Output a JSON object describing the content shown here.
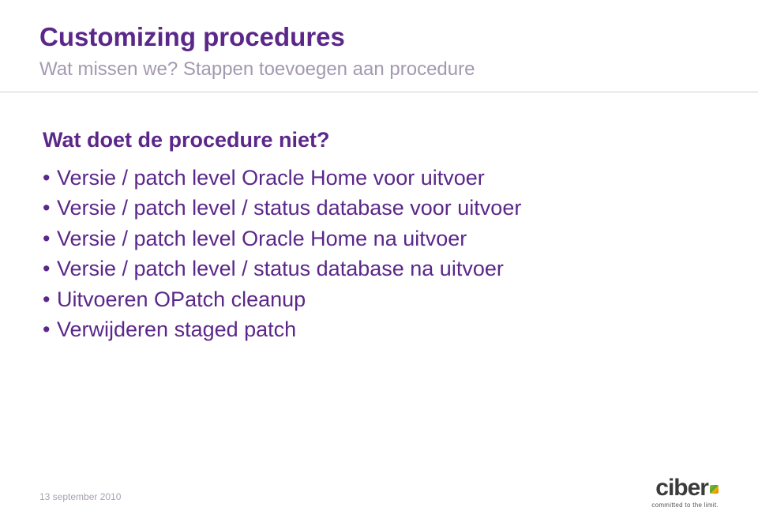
{
  "title": "Customizing procedures",
  "subtitle": "Wat missen we? Stappen toevoegen aan procedure",
  "question": "Wat doet de procedure niet?",
  "bullets": [
    "Versie / patch level Oracle Home voor uitvoer",
    "Versie / patch level / status database voor uitvoer",
    "Versie / patch level Oracle Home na uitvoer",
    "Versie / patch level / status database na uitvoer",
    "Uitvoeren OPatch cleanup",
    "Verwijderen staged patch"
  ],
  "footer_date": "13 september 2010",
  "logo": {
    "name": "ciber",
    "tagline": "committed to the limit."
  }
}
